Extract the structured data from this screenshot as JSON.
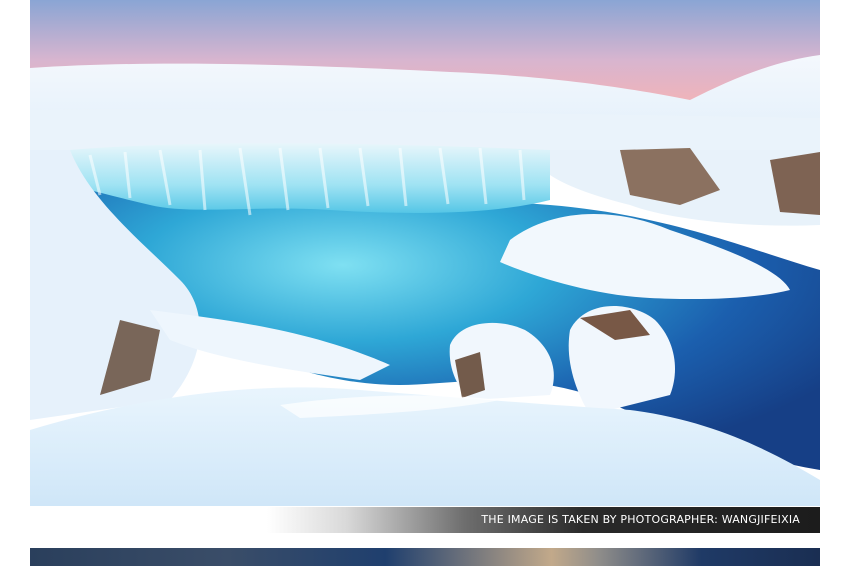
{
  "photo": {
    "subject": "frozen-waterfall-photo",
    "colors": {
      "sky_top": "#8fa9d6",
      "sky_glow": "#f3b0b8",
      "water_deep": "#1e4f9c",
      "water_mist": "#5fd0ea",
      "snow": "#eef6fd",
      "rock": "#6a4a36"
    }
  },
  "caption": {
    "text": "THE IMAGE IS TAKEN BY PHOTOGRAPHER: WANGJIFEIXIA"
  },
  "next_photo": {
    "subject": "next-photo-preview"
  }
}
